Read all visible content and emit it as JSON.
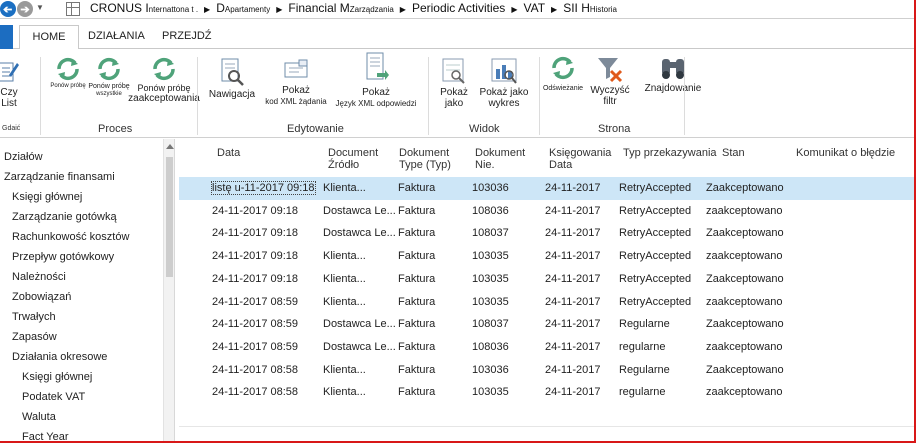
{
  "address": {
    "back_glyph": "➔",
    "forward_glyph": "➔",
    "dropdown_glyph": "▼",
    "crumbs": [
      {
        "main": "CRONUS I",
        "small": "nternattona t ."
      },
      {
        "main": "D",
        "small": "Apartamenty"
      },
      {
        "main": "Financial M",
        "small": "Zarządzania"
      },
      {
        "main": "Periodic Activities",
        "small": ""
      },
      {
        "main": "VAT",
        "small": ""
      },
      {
        "main": "SII H",
        "small": "Historia"
      }
    ],
    "sep_glyph": "▶"
  },
  "tabs": {
    "home": "HOME",
    "actions": "DZIAŁANIA",
    "goto": "PRZEJDŹ"
  },
  "ribbon": {
    "left_partial": {
      "line1": "Czy",
      "line2": "List",
      "group": "Gdaić"
    },
    "proces": {
      "label": "Proces",
      "b1": "Ponów próbę",
      "b2a": "Ponów próbę",
      "b2b": "wszystkie",
      "b3a": "Ponów próbę",
      "b3b": "zaakceptowania"
    },
    "edytowanie": {
      "label": "Edytowanie",
      "nav": "Nawigacja",
      "show1a": "Pokaż",
      "show1b": "kod XML żądania",
      "show2a": "Pokaż",
      "show2b": "Język XML odpowiedzi"
    },
    "widok": {
      "label": "Widok",
      "as_list_a": "Pokaż",
      "as_list_b": "jako",
      "as_chart_a": "Pokaż jako",
      "as_chart_b": "wykres"
    },
    "strona": {
      "label": "Strona",
      "refresh": "Odświeżanie",
      "clear_a": "Wyczyść",
      "clear_b": "filtr",
      "find": "Znajdowanie"
    }
  },
  "sidebar": {
    "items": [
      {
        "label": "Działów",
        "indent": 0
      },
      {
        "label": "Zarządzanie finansami",
        "indent": 0
      },
      {
        "label": "Księgi głównej",
        "indent": 1
      },
      {
        "label": "Zarządzanie gotówką",
        "indent": 1
      },
      {
        "label": "Rachunkowość kosztów",
        "indent": 1
      },
      {
        "label": "Przepływ gotówkowy",
        "indent": 1
      },
      {
        "label": "Należności",
        "indent": 1
      },
      {
        "label": "Zobowiązań",
        "indent": 1
      },
      {
        "label": "Trwałych",
        "indent": 1
      },
      {
        "label": "Zapasów",
        "indent": 1
      },
      {
        "label": "Działania okresowe",
        "indent": 1
      },
      {
        "label": "Księgi głównej",
        "indent": 2
      },
      {
        "label": "Podatek VAT",
        "indent": 2
      },
      {
        "label": "Waluta",
        "indent": 2
      },
      {
        "label": "Fact Year",
        "indent": 2
      }
    ]
  },
  "table": {
    "columns": [
      {
        "l1": "Data",
        "l2": ""
      },
      {
        "l1": "Document",
        "l2": "Źródło"
      },
      {
        "l1": "Dokument",
        "l2": "Type (Typ)"
      },
      {
        "l1": "Dokument",
        "l2": "Nie."
      },
      {
        "l1": "Księgowania",
        "l2": "Data"
      },
      {
        "l1": "Typ przekazywania",
        "l2": ""
      },
      {
        "l1": "Stan",
        "l2": ""
      },
      {
        "l1": "Komunikat o błędzie",
        "l2": ""
      }
    ],
    "rows": [
      [
        "listę u-11-2017 09:18",
        "Klienta...",
        "Faktura",
        "103036",
        "24-11-2017",
        "RetryAccepted",
        "Zaakceptowano"
      ],
      [
        "24-11-2017 09:18",
        "Dostawca Le...",
        "Faktura",
        "108036",
        "24-11-2017",
        "RetryAccepted",
        "zaakceptowano"
      ],
      [
        "24-11-2017 09:18",
        "Dostawca Le...",
        "Faktura",
        "108037",
        "24-11-2017",
        "RetryAccepted",
        "Zaakceptowano"
      ],
      [
        "24-11-2017 09:18",
        "Klienta...",
        "Faktura",
        "103035",
        "24-11-2017",
        "RetryAccepted",
        "zaakceptowano"
      ],
      [
        "24-11-2017 09:18",
        "Klienta...",
        "Faktura",
        "103035",
        "24-11-2017",
        "RetryAccepted",
        "Zaakceptowano"
      ],
      [
        "24-11-2017 08:59",
        "Klienta...",
        "Faktura",
        "103035",
        "24-11-2017",
        "RetryAccepted",
        "zaakceptowano"
      ],
      [
        "24-11-2017 08:59",
        "Dostawca Le...",
        "Faktura",
        "108037",
        "24-11-2017",
        "Regularne",
        "Zaakceptowano"
      ],
      [
        "24-11-2017 08:59",
        "Dostawca Le...",
        "Faktura",
        "108036",
        "24-11-2017",
        "regularne",
        "zaakceptowano"
      ],
      [
        "24-11-2017 08:58",
        "Klienta...",
        "Faktura",
        "103036",
        "24-11-2017",
        "Regularne",
        "Zaakceptowano"
      ],
      [
        "24-11-2017 08:58",
        "Klienta...",
        "Faktura",
        "103035",
        "24-11-2017",
        "regularne",
        "zaakceptowano"
      ]
    ]
  },
  "colors": {
    "accent": "#1c6dc1",
    "selected_row": "#cde6f7",
    "frame": "#d81818",
    "green": "#4fa37a"
  }
}
